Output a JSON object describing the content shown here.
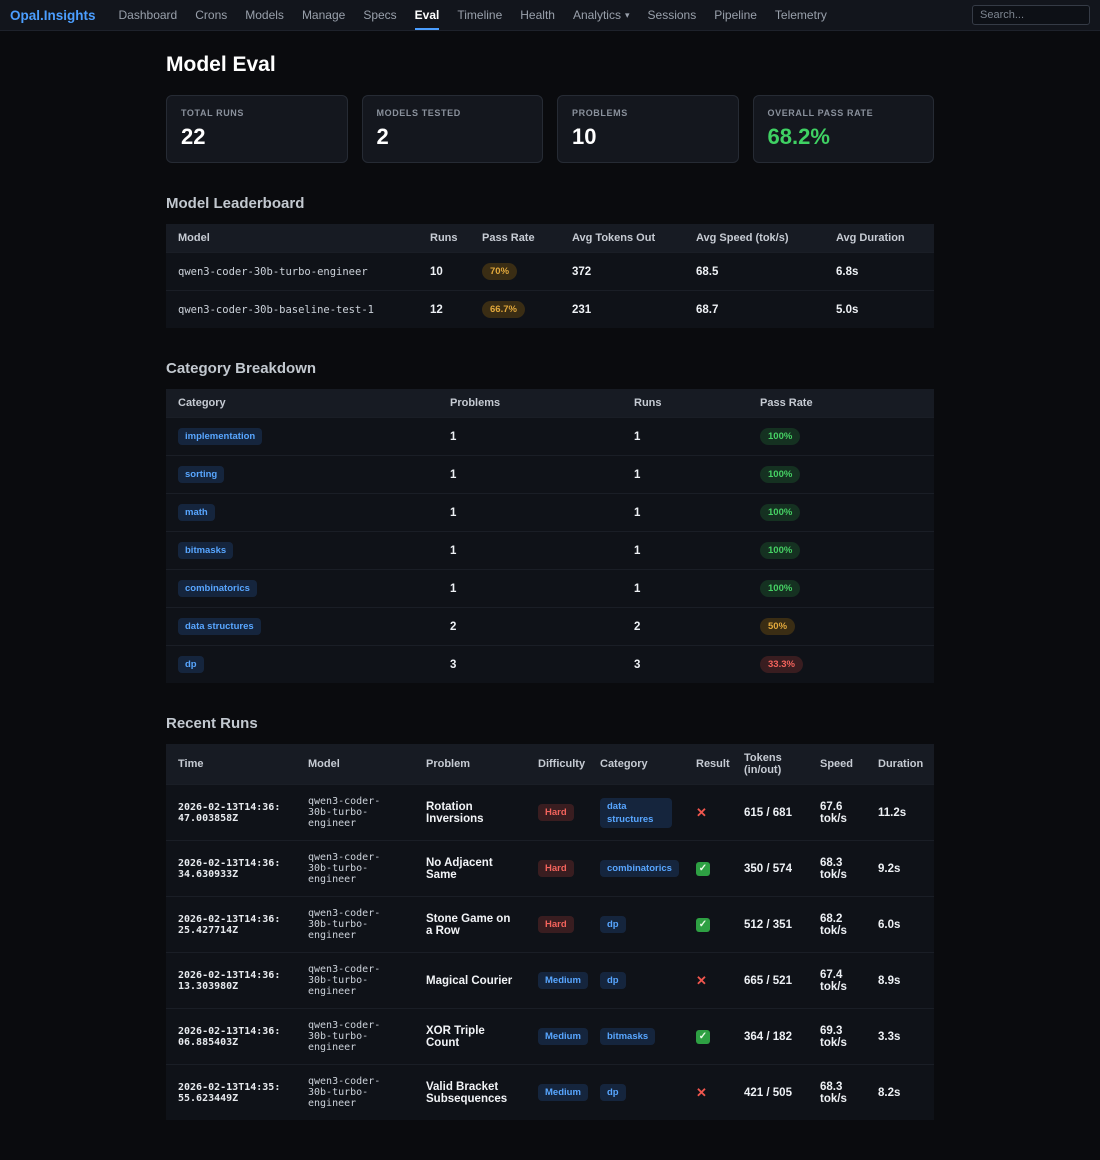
{
  "app": {
    "logo": "Opal.Insights",
    "search_placeholder": "Search...",
    "nav": [
      {
        "label": "Dashboard"
      },
      {
        "label": "Crons"
      },
      {
        "label": "Models"
      },
      {
        "label": "Manage"
      },
      {
        "label": "Specs"
      },
      {
        "label": "Eval",
        "active": true
      },
      {
        "label": "Timeline"
      },
      {
        "label": "Health"
      },
      {
        "label": "Analytics",
        "has_dropdown": true
      },
      {
        "label": "Sessions"
      },
      {
        "label": "Pipeline"
      },
      {
        "label": "Telemetry"
      }
    ]
  },
  "page": {
    "title": "Model Eval"
  },
  "stats": [
    {
      "label": "TOTAL RUNS",
      "value": "22"
    },
    {
      "label": "MODELS TESTED",
      "value": "2"
    },
    {
      "label": "PROBLEMS",
      "value": "10"
    },
    {
      "label": "OVERALL PASS RATE",
      "value": "68.2%",
      "tone": "green"
    }
  ],
  "leaderboard": {
    "title": "Model Leaderboard",
    "columns": [
      "Model",
      "Runs",
      "Pass Rate",
      "Avg Tokens Out",
      "Avg Speed (tok/s)",
      "Avg Duration"
    ],
    "rows": [
      {
        "model": "qwen3-coder-30b-turbo-engineer",
        "runs": "10",
        "pass_rate": "70%",
        "pass_tone": "orange",
        "avg_tokens_out": "372",
        "avg_speed": "68.5",
        "avg_duration": "6.8s"
      },
      {
        "model": "qwen3-coder-30b-baseline-test-1",
        "runs": "12",
        "pass_rate": "66.7%",
        "pass_tone": "orange",
        "avg_tokens_out": "231",
        "avg_speed": "68.7",
        "avg_duration": "5.0s"
      }
    ]
  },
  "categories": {
    "title": "Category Breakdown",
    "columns": [
      "Category",
      "Problems",
      "Runs",
      "Pass Rate"
    ],
    "rows": [
      {
        "category": "implementation",
        "problems": "1",
        "runs": "1",
        "pass_rate": "100%",
        "pass_tone": "green"
      },
      {
        "category": "sorting",
        "problems": "1",
        "runs": "1",
        "pass_rate": "100%",
        "pass_tone": "green"
      },
      {
        "category": "math",
        "problems": "1",
        "runs": "1",
        "pass_rate": "100%",
        "pass_tone": "green"
      },
      {
        "category": "bitmasks",
        "problems": "1",
        "runs": "1",
        "pass_rate": "100%",
        "pass_tone": "green"
      },
      {
        "category": "combinatorics",
        "problems": "1",
        "runs": "1",
        "pass_rate": "100%",
        "pass_tone": "green"
      },
      {
        "category": "data structures",
        "problems": "2",
        "runs": "2",
        "pass_rate": "50%",
        "pass_tone": "orange"
      },
      {
        "category": "dp",
        "problems": "3",
        "runs": "3",
        "pass_rate": "33.3%",
        "pass_tone": "red"
      }
    ]
  },
  "recent_runs": {
    "title": "Recent Runs",
    "columns": [
      "Time",
      "Model",
      "Problem",
      "Difficulty",
      "Category",
      "Result",
      "Tokens (in/out)",
      "Speed",
      "Duration"
    ],
    "rows": [
      {
        "time": "2026-02-13T14:36:47.003858Z",
        "model": "qwen3-coder-30b-turbo-engineer",
        "problem": "Rotation Inversions",
        "difficulty": "Hard",
        "category": "data structures",
        "result": "fail",
        "tokens": "615 / 681",
        "speed": "67.6 tok/s",
        "duration": "11.2s"
      },
      {
        "time": "2026-02-13T14:36:34.630933Z",
        "model": "qwen3-coder-30b-turbo-engineer",
        "problem": "No Adjacent Same",
        "difficulty": "Hard",
        "category": "combinatorics",
        "result": "pass",
        "tokens": "350 / 574",
        "speed": "68.3 tok/s",
        "duration": "9.2s"
      },
      {
        "time": "2026-02-13T14:36:25.427714Z",
        "model": "qwen3-coder-30b-turbo-engineer",
        "problem": "Stone Game on a Row",
        "difficulty": "Hard",
        "category": "dp",
        "result": "pass",
        "tokens": "512 / 351",
        "speed": "68.2 tok/s",
        "duration": "6.0s"
      },
      {
        "time": "2026-02-13T14:36:13.303980Z",
        "model": "qwen3-coder-30b-turbo-engineer",
        "problem": "Magical Courier",
        "difficulty": "Medium",
        "category": "dp",
        "result": "fail",
        "tokens": "665 / 521",
        "speed": "67.4 tok/s",
        "duration": "8.9s"
      },
      {
        "time": "2026-02-13T14:36:06.885403Z",
        "model": "qwen3-coder-30b-turbo-engineer",
        "problem": "XOR Triple Count",
        "difficulty": "Medium",
        "category": "bitmasks",
        "result": "pass",
        "tokens": "364 / 182",
        "speed": "69.3 tok/s",
        "duration": "3.3s"
      },
      {
        "time": "2026-02-13T14:35:55.623449Z",
        "model": "qwen3-coder-30b-turbo-engineer",
        "problem": "Valid Bracket Subsequences",
        "difficulty": "Medium",
        "category": "dp",
        "result": "fail",
        "tokens": "421 / 505",
        "speed": "68.3 tok/s",
        "duration": "8.2s"
      }
    ]
  },
  "colors": {
    "accent_blue": "#4b9eff",
    "success_green": "#3fd163",
    "warning_orange": "#e3a93c",
    "danger_red": "#f0564e",
    "badge_blue": "#58a6ff"
  }
}
